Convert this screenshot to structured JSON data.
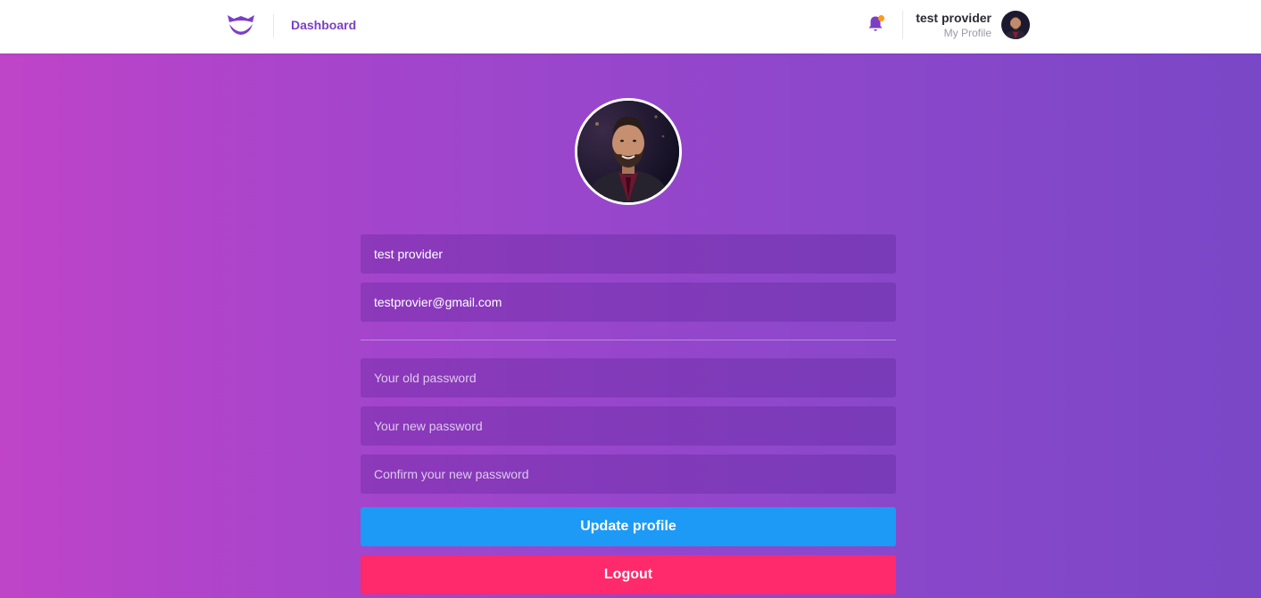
{
  "colors": {
    "brand_purple": "#7b3fc4",
    "gradient_start": "#bf44c8",
    "gradient_end": "#7a47c7",
    "update_button": "#1c9af6",
    "logout_button": "#fe2a6c",
    "notification_dot": "#ff9a1a"
  },
  "header": {
    "logo_icon": "mustache-smile-logo",
    "nav_link": "Dashboard",
    "notification_icon": "bell-icon",
    "user": {
      "name": "test provider",
      "subtitle": "My Profile",
      "avatar_icon": "user-avatar"
    }
  },
  "profile": {
    "avatar_icon": "profile-photo",
    "name_value": "test provider",
    "email_value": "testprovier@gmail.com",
    "old_password_placeholder": "Your old password",
    "new_password_placeholder": "Your new password",
    "confirm_password_placeholder": "Confirm your new password",
    "update_label": "Update profile",
    "logout_label": "Logout"
  }
}
